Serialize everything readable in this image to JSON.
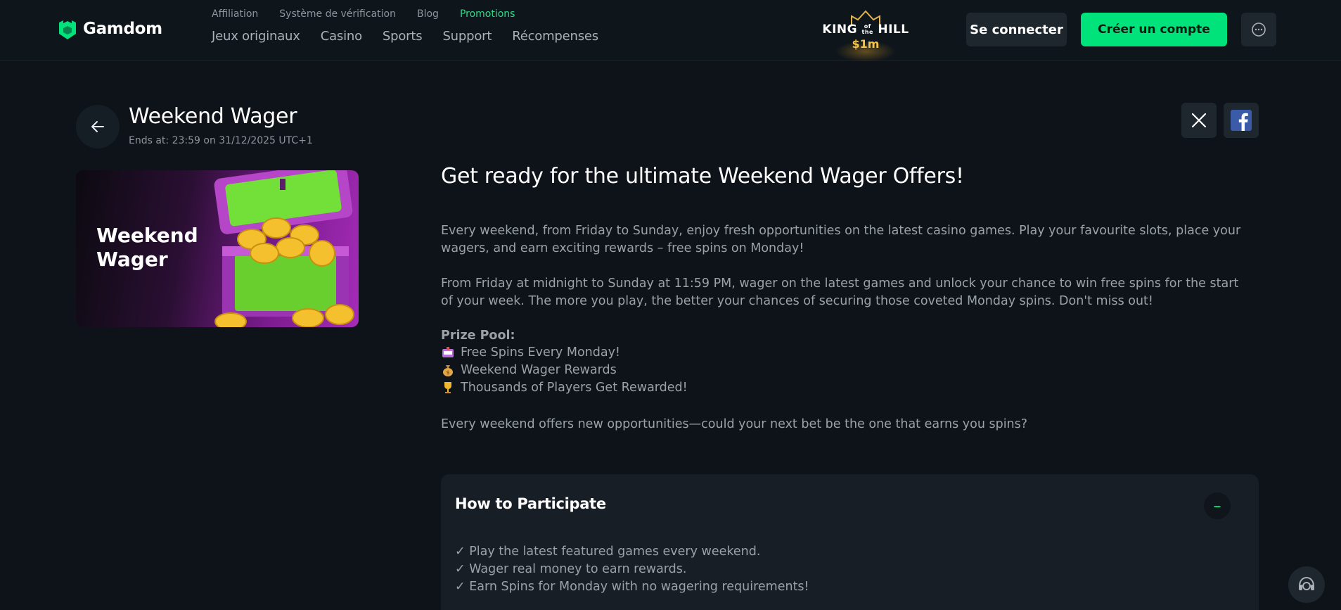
{
  "brand": {
    "name": "Gamdom",
    "accent": "#00e37a",
    "background": "#0d1318"
  },
  "top_links": [
    {
      "label": "Affiliation"
    },
    {
      "label": "Système de vérification"
    },
    {
      "label": "Blog"
    },
    {
      "label": "Promotions",
      "active": true
    }
  ],
  "main_nav": [
    {
      "label": "Jeux originaux"
    },
    {
      "label": "Casino"
    },
    {
      "label": "Sports"
    },
    {
      "label": "Support"
    },
    {
      "label": "Récompenses"
    }
  ],
  "king_of_the_hill": {
    "title_left": "KING",
    "title_small_top": "of",
    "title_small_bottom": "the",
    "title_right": "HILL",
    "amount": "$1m"
  },
  "auth": {
    "login_label": "Se connecter",
    "register_label": "Créer un compte"
  },
  "promo": {
    "title": "Weekend Wager",
    "ends_at": "Ends at: 23:59 on 31/12/2025 UTC+1",
    "banner_title_line1": "Weekend",
    "banner_title_line2": "Wager"
  },
  "share": {
    "x_icon": "x-logo-icon",
    "facebook_icon": "facebook-logo-icon"
  },
  "content": {
    "headline": "Get ready for the ultimate Weekend Wager Offers!",
    "paragraph1": "Every weekend, from Friday to Sunday, enjoy fresh opportunities on the latest casino games. Play your favourite slots, place your wagers, and earn exciting rewards – free spins on Monday!",
    "paragraph2": "From Friday at midnight to Sunday at 11:59 PM, wager on the latest games and unlock your chance to win free spins for the start of your week. The more you play, the better your chances of securing those coveted Monday spins. Don't miss out!",
    "prize_label": "Prize Pool:",
    "prizes": [
      {
        "icon": "slot-machine-icon",
        "text": "Free Spins Every Monday!"
      },
      {
        "icon": "money-bag-icon",
        "text": "Weekend Wager Rewards"
      },
      {
        "icon": "trophy-icon",
        "text": "Thousands of Players Get Rewarded!"
      }
    ],
    "paragraph3": "Every weekend offers new opportunities—could your next bet be the one that earns you spins?"
  },
  "participate": {
    "title": "How to Participate",
    "toggle_symbol": "–",
    "items": [
      "✓ Play the latest featured games every weekend.",
      "✓ Wager real money to earn rewards.",
      "✓ Earn Spins for Monday with no wagering requirements!"
    ]
  }
}
